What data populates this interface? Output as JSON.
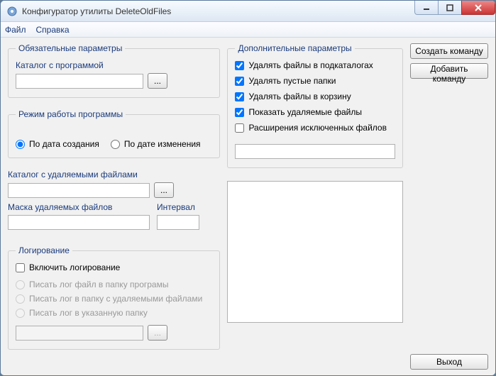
{
  "window": {
    "title": "Конфигуратор утилиты DeleteOldFiles"
  },
  "menu": {
    "file": "Файл",
    "help": "Справка"
  },
  "mandatory": {
    "legend": "Обязательные параметры",
    "catalog_label": "Каталог с программой",
    "catalog_value": "",
    "browse": "..."
  },
  "mode": {
    "legend": "Режим работы программы",
    "by_created": "По дата создания",
    "by_modified": "По дате изменения"
  },
  "del": {
    "catalog_label": "Каталог с удаляемыми файлами",
    "catalog_value": "",
    "browse": "...",
    "mask_label": "Маска удаляемых файлов",
    "mask_value": "",
    "interval_label": "Интервал",
    "interval_value": ""
  },
  "log": {
    "legend": "Логирование",
    "enable": "Включить логирование",
    "opt1": "Писать лог файл в папку програмы",
    "opt2": "Писать лог в папку с удаляемыми файлами",
    "opt3": "Писать лог в указанную папку",
    "path_value": "",
    "browse": "..."
  },
  "optional": {
    "legend": "Дополнительные параметры",
    "del_subdirs": "Удалять файлы в подкаталогах",
    "del_empty": "Удалять пустые папки",
    "del_recycle": "Удалять файлы в корзину",
    "show_deleted": "Показать удаляемые файлы",
    "ext_excluded": "Расширения исключенных файлов",
    "ext_value": ""
  },
  "actions": {
    "create": "Создать команду",
    "add": "Добавить команду",
    "exit": "Выход"
  },
  "output": ""
}
